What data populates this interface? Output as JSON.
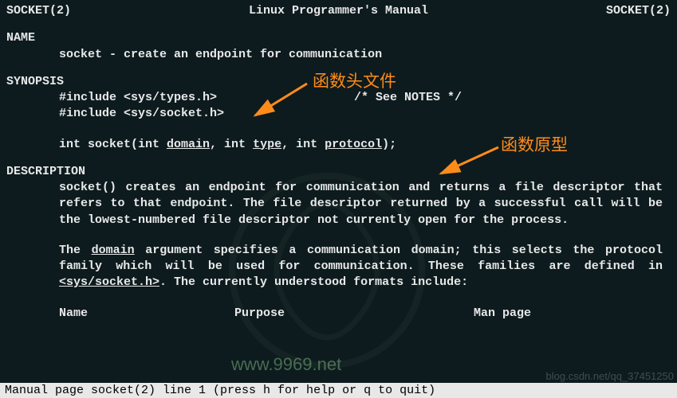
{
  "header": {
    "left": "SOCKET(2)",
    "center": "Linux Programmer's Manual",
    "right": "SOCKET(2)"
  },
  "sections": {
    "name_title": "NAME",
    "name_line": "socket - create an endpoint for communication",
    "synopsis_title": "SYNOPSIS",
    "include1": "#include <sys/types.h>",
    "include1_note": "/* See NOTES */",
    "include2": "#include <sys/socket.h>",
    "proto_pre": "int socket(int ",
    "proto_arg1": "domain",
    "proto_mid1": ", int ",
    "proto_arg2": "type",
    "proto_mid2": ", int ",
    "proto_arg3": "protocol",
    "proto_post": ");",
    "desc_title": "DESCRIPTION",
    "desc_fn": "socket",
    "desc_p1_rest": "()  creates  an endpoint for communication and returns a file descriptor that refers to that endpoint.  The file descriptor returned by a  successful call will be the lowest-numbered file descriptor not currently open for the process.",
    "desc_p2_a": "The ",
    "desc_p2_arg": "domain",
    "desc_p2_b": " argument specifies a communication domain; this selects  the protocol  family  which will be used for communication.  These families are defined in ",
    "desc_p2_hdr": "<sys/socket.h>",
    "desc_p2_c": ".  The currently  understood  formats  include:",
    "col_name": "Name",
    "col_purpose": "Purpose",
    "col_manpage": "Man page"
  },
  "annotations": {
    "header_files": "函数头文件",
    "prototype": "函数原型"
  },
  "statusbar": "Manual page socket(2) line 1 (press h for help or q to quit)",
  "watermarks": {
    "site": "www.9969.net",
    "url": "blog.csdn.net/qq_37451250"
  }
}
